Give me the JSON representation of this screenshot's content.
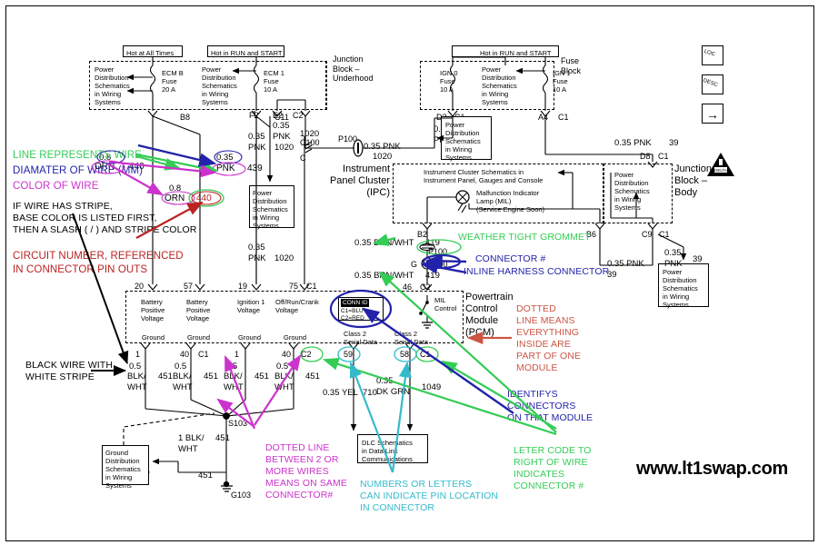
{
  "meta": {
    "watermark": "www.lt1swap.com",
    "bg": "#ffffff"
  },
  "colors": {
    "green": "#33cc55",
    "blue": "#2222aa",
    "magenta": "#cc33cc",
    "red": "#bb2222",
    "cyan": "#33bbcc",
    "black": "#000000"
  },
  "legend": [
    {
      "id": "line-represents-wire",
      "text": "LINE REPRESENTS WIRE",
      "color": "#33cc55"
    },
    {
      "id": "diameter-of-wire",
      "text": "DIAMATER OF WIRE (MM)",
      "color": "#2222aa"
    },
    {
      "id": "color-of-wire",
      "text": "COLOR OF WIRE",
      "color": "#cc33cc"
    },
    {
      "id": "stripe-note",
      "text": "IF WIRE HAS STRIPE,\nBASE COLOR IS LISTED FIRST,\nTHEN A SLASH ( / ) AND STRIPE COLOR",
      "color": "#000000"
    },
    {
      "id": "circuit-number",
      "text": "CIRCUIT NUMBER, REFERENCED\nIN CONNECTOR PIN OUTS",
      "color": "#bb2222"
    },
    {
      "id": "black-white-stripe",
      "text": "BLACK WIRE WITH\nWHITE STRIPE",
      "color": "#000000"
    },
    {
      "id": "dotted-line-wires",
      "text": "DOTTED LINE\nBETWEEN 2 OR\nMORE WIRES\nMEANS ON SAME\nCONNECTOR#",
      "color": "#cc33cc"
    },
    {
      "id": "numbers-letters-pin",
      "text": "NUMBERS OR LETTERS\nCAN INDICATE PIN LOCATION\nIN CONNECTOR",
      "color": "#33bbcc"
    },
    {
      "id": "weather-tight-grommet",
      "text": "WEATHER TIGHT GROMMET",
      "color": "#33cc55"
    },
    {
      "id": "connector-number",
      "text": "CONNECTOR #",
      "color": "#2222aa"
    },
    {
      "id": "inline-harness-connector",
      "text": "INLINE HARNESS CONNECTOR",
      "color": "#2222aa"
    },
    {
      "id": "dotted-line-module",
      "text": "DOTTED\nLINE MEANS\nEVERYTHING\nINSIDE ARE\nPART OF ONE\nMODULE",
      "color": "#cc5544"
    },
    {
      "id": "identifys-connectors",
      "text": "IDENTIFYS\nCONNECTORS\nON THAT MODULE",
      "color": "#2222aa"
    },
    {
      "id": "letter-code",
      "text": "LETER CODE TO\nRIGHT OF WIRE\nINDICATES\nCONNECTOR #",
      "color": "#33cc55"
    }
  ],
  "headers": {
    "hot_all_times": "Hot at All Times",
    "hot_run_start_left": "Hot in RUN and START",
    "hot_run_start_right": "Hot in RUN and START"
  },
  "blocks": {
    "junction_underhood": "Junction\nBlock –\nUnderhood",
    "fuse_block": "Fuse\nBlock",
    "junction_body": "Junction\nBlock –\nBody",
    "ipc": "Instrument\nPanel Cluster\n(IPC)",
    "pcm": "Powertrain\nControl\nModule\n(PCM)"
  },
  "pdboxes": {
    "pd1": "Power\nDistribution\nSchematics\nin Wiring\nSystems",
    "pd2": "Power\nDistribution\nSchematics\nin Wiring\nSystems",
    "pd3": "Power\nDistribution\nSchematics\nin Wiring\nSystems",
    "pd4": "Power\nDistribution\nSchematics\nin Wiring\nSystems",
    "pd5": "Power\nDistribution\nSchematics\nin Wiring\nSystems",
    "pd6": "Power\nDistribution\nSchematics\nin Wiring\nSystems",
    "pd7": "Power\nDistribution\nSchematics\nin Wiring\nSystems",
    "ground_dist": "Ground\nDistribution\nSchematics\nin Wiring\nSystems",
    "dlc": "DLC Schematics\nin Data Link\nCommunications",
    "ipc_ref": "Instrument Cluster Schematics in\nInstrument Panel, Gauges and Console"
  },
  "fuses": [
    {
      "name": "ECM B\nFuse\n20 A",
      "pin": "B8"
    },
    {
      "name": "ECM 1\nFuse\n10 A",
      "pin": "C11"
    },
    {
      "name": "IGN 0\nFuse\n10 A",
      "pin": "D3",
      "conn": "C1"
    },
    {
      "name": "IGN 1\nFuse\n10 A",
      "pin": "A4",
      "conn": "C1"
    }
  ],
  "wires": [
    {
      "id": "w-08-orn-440-a",
      "gauge": "0.8",
      "color": "ORN",
      "circuit": "440",
      "circled": true
    },
    {
      "id": "w-035-pnk-439",
      "gauge": "0.35",
      "color": "PNK",
      "circuit": "439",
      "circled": true
    },
    {
      "id": "w-08-orn-440-b",
      "gauge": "0.8",
      "color": "ORN",
      "circuit": "440",
      "circled": true
    },
    {
      "id": "w-035-pnk-1020-f2",
      "gauge": "0.35",
      "color": "PNK",
      "circuit": "1020"
    },
    {
      "id": "w-035-pnk-1020-e2",
      "gauge": "0.35",
      "color": "PNK",
      "circuit": "1020"
    },
    {
      "id": "w-035-pnk-1020-p100",
      "gauge": "0.35 PNK",
      "circuit": "1020"
    },
    {
      "id": "w-035-pnk-1020-d3",
      "gauge": "0.35",
      "color": "PNK",
      "circuit": "1020"
    },
    {
      "id": "w-035-pnk-1020-bot",
      "gauge": "0.35",
      "color": "PNK",
      "circuit": "1020"
    },
    {
      "id": "w-035-pnk-39-a4",
      "gauge": "0.35 PNK",
      "circuit": "39"
    },
    {
      "id": "w-035-pnk-39-b6",
      "gauge": "0.35 PNK",
      "circuit": "39"
    },
    {
      "id": "w-035-pnk-39-c9",
      "gauge": "0.35\nPNK",
      "circuit": "39"
    },
    {
      "id": "w-035-brnwht-419-b2",
      "gauge": "0.35 BRN/WHT",
      "circuit": "419"
    },
    {
      "id": "w-035-brnwht-419-c2",
      "gauge": "0.35 BRN/WHT",
      "circuit": "419"
    },
    {
      "id": "w-05-blkwht-451-1",
      "gauge": "0.5",
      "color": "BLK/\nWHT",
      "circuit": "451"
    },
    {
      "id": "w-05-blkwht-451-2",
      "gauge": "0.5",
      "color": "BLK/\nWHT",
      "circuit": "451"
    },
    {
      "id": "w-05-blkwht-451-3",
      "gauge": "0.5",
      "color": "BLK/\nWHT",
      "circuit": "451"
    },
    {
      "id": "w-05-blkwht-451-4",
      "gauge": "0.5",
      "color": "BLK/\nWHT",
      "circuit": "451"
    },
    {
      "id": "w-1-blkwht-451-s103",
      "gauge": "1 BLK/\nWHT",
      "circuit": "451"
    },
    {
      "id": "w-1-blkwht-451-gnd",
      "gauge": "1 BLK/WHT",
      "circuit": "451"
    },
    {
      "id": "w-035-yel-710",
      "gauge": "0.35 YEL",
      "circuit": "710"
    },
    {
      "id": "w-035-dkgrn-1049",
      "gauge": "0.35\nDK GRN",
      "circuit": "1049"
    }
  ],
  "connectors": {
    "p100": "P100",
    "c100": "C100",
    "c100_top": "C100",
    "p100_top": "P100",
    "c_letter": "C",
    "g_letter": "G",
    "conn_id_title": "CONN ID",
    "conn_id_l1": "C1=BLU",
    "conn_id_l2": "C2=RED",
    "s103": "S103",
    "g103": "G103",
    "delta": "DELTA"
  },
  "pins": {
    "b8": "B8",
    "c11": "C11",
    "f2": "F2",
    "e2": "E2",
    "c2_top": "C2",
    "d3": "D3",
    "c1_d3": "C1",
    "a4": "A4",
    "c1_a4": "C1",
    "d8": "D8",
    "c1_d8": "C1",
    "b6": "B6",
    "c9": "C9",
    "c1_c9": "C1",
    "b2": "B2",
    "c2_419": "C2",
    "p46": "46",
    "p20": "20",
    "p57": "57",
    "p19": "19",
    "p75": "75",
    "c1_75": "C1",
    "g1": "1",
    "g40a": "40",
    "c1_g": "C1",
    "g1b": "1",
    "g40b": "40",
    "c2_g": "C2",
    "p59": "59",
    "p58": "58",
    "c1_58": "C1"
  },
  "pcm_labels": {
    "batt1": "Battery\nPositive\nVoltage",
    "batt2": "Battery\nPositive\nVoltage",
    "ign1": "Ignition 1\nVoltage",
    "offrun": "Off/Run/Crank\nVoltage",
    "ground1": "Ground",
    "ground2": "Ground",
    "ground3": "Ground",
    "ground4": "Ground",
    "class2a": "Class 2\nSerial Data",
    "class2b": "Class 2\nSerial Data",
    "mil_control": "MIL\nControl"
  },
  "mil": {
    "label": "Malfunction Indicator\nLamp (MIL)\n(Service Engine Soon)"
  },
  "icons": {
    "loc": "LOC",
    "desc": "DESC",
    "arrow": "→"
  }
}
